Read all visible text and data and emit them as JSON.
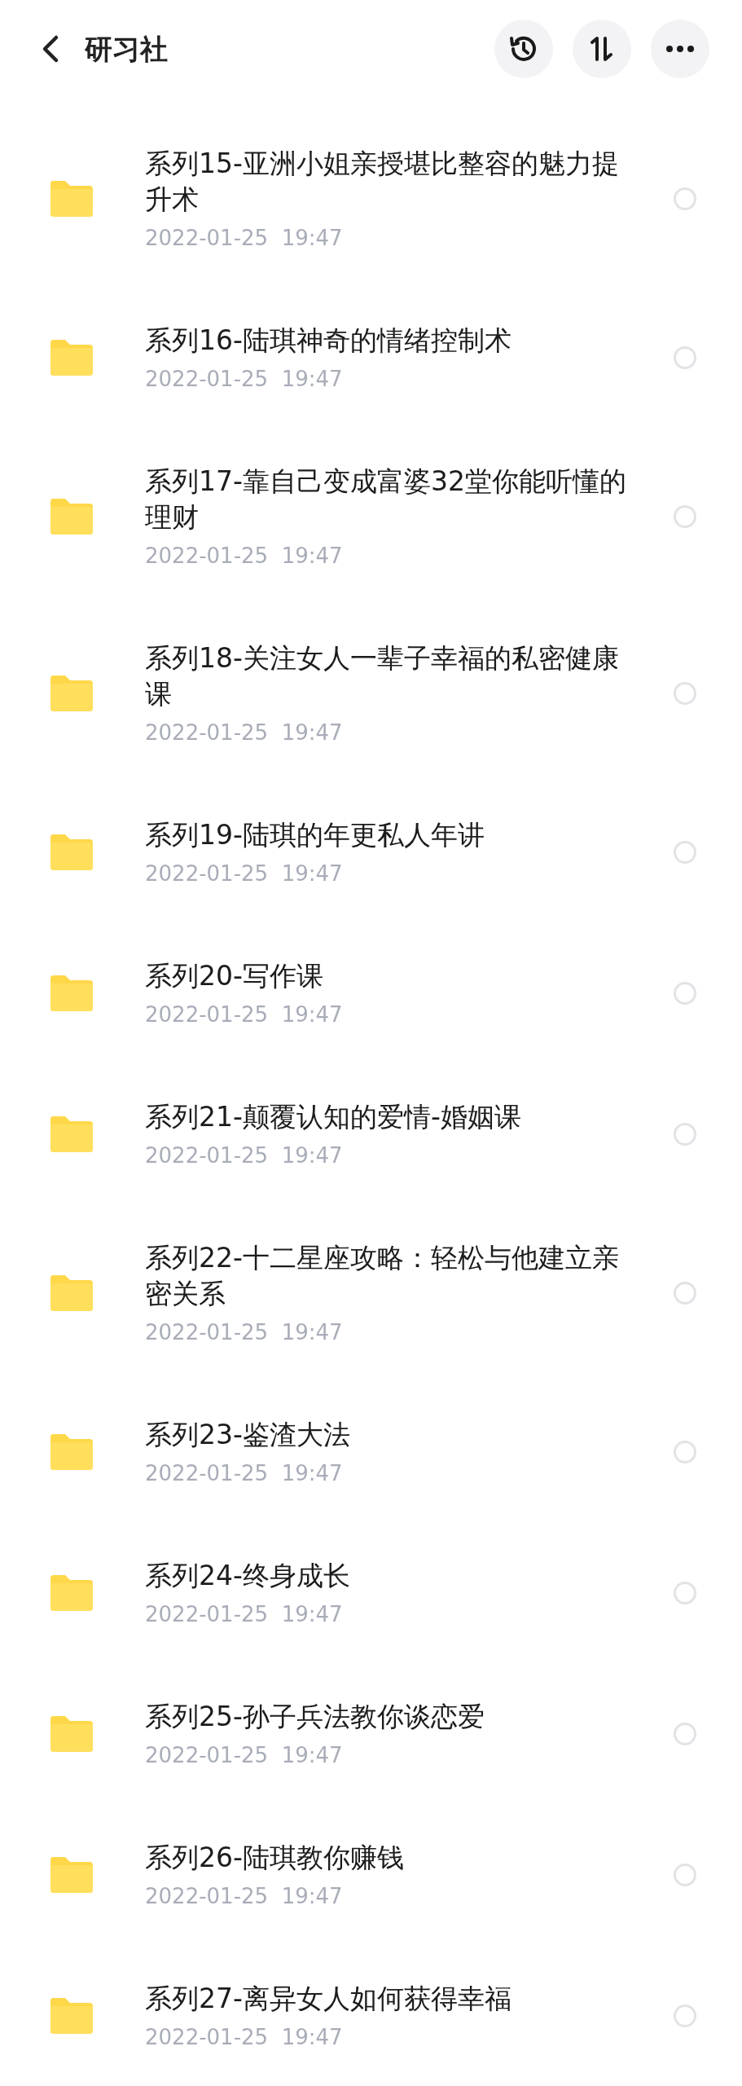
{
  "header": {
    "title": "研习社"
  },
  "files": [
    {
      "name": "系列15-亚洲小姐亲授堪比整容的魅力提升术",
      "date": "2022-01-25  19:47",
      "selected": false
    },
    {
      "name": "系列16-陆琪神奇的情绪控制术",
      "date": "2022-01-25  19:47",
      "selected": false
    },
    {
      "name": "系列17-靠自己变成富婆32堂你能听懂的理财",
      "date": "2022-01-25  19:47",
      "selected": false
    },
    {
      "name": "系列18-关注女人一辈子幸福的私密健康课",
      "date": "2022-01-25  19:47",
      "selected": false
    },
    {
      "name": "系列19-陆琪的年更私人年讲",
      "date": "2022-01-25  19:47",
      "selected": false
    },
    {
      "name": "系列20-写作课",
      "date": "2022-01-25  19:47",
      "selected": false
    },
    {
      "name": "系列21-颠覆认知的爱情-婚姻课",
      "date": "2022-01-25  19:47",
      "selected": false
    },
    {
      "name": "系列22-十二星座攻略：轻松与他建立亲密关系",
      "date": "2022-01-25  19:47",
      "selected": false
    },
    {
      "name": "系列23-鉴渣大法",
      "date": "2022-01-25  19:47",
      "selected": false
    },
    {
      "name": "系列24-终身成长",
      "date": "2022-01-25  19:47",
      "selected": false
    },
    {
      "name": "系列25-孙子兵法教你谈恋爱",
      "date": "2022-01-25  19:47",
      "selected": false
    },
    {
      "name": "系列26-陆琪教你赚钱",
      "date": "2022-01-25  19:47",
      "selected": false
    },
    {
      "name": "系列27-离异女人如何获得幸福",
      "date": "2022-01-25  19:47",
      "selected": false
    }
  ]
}
